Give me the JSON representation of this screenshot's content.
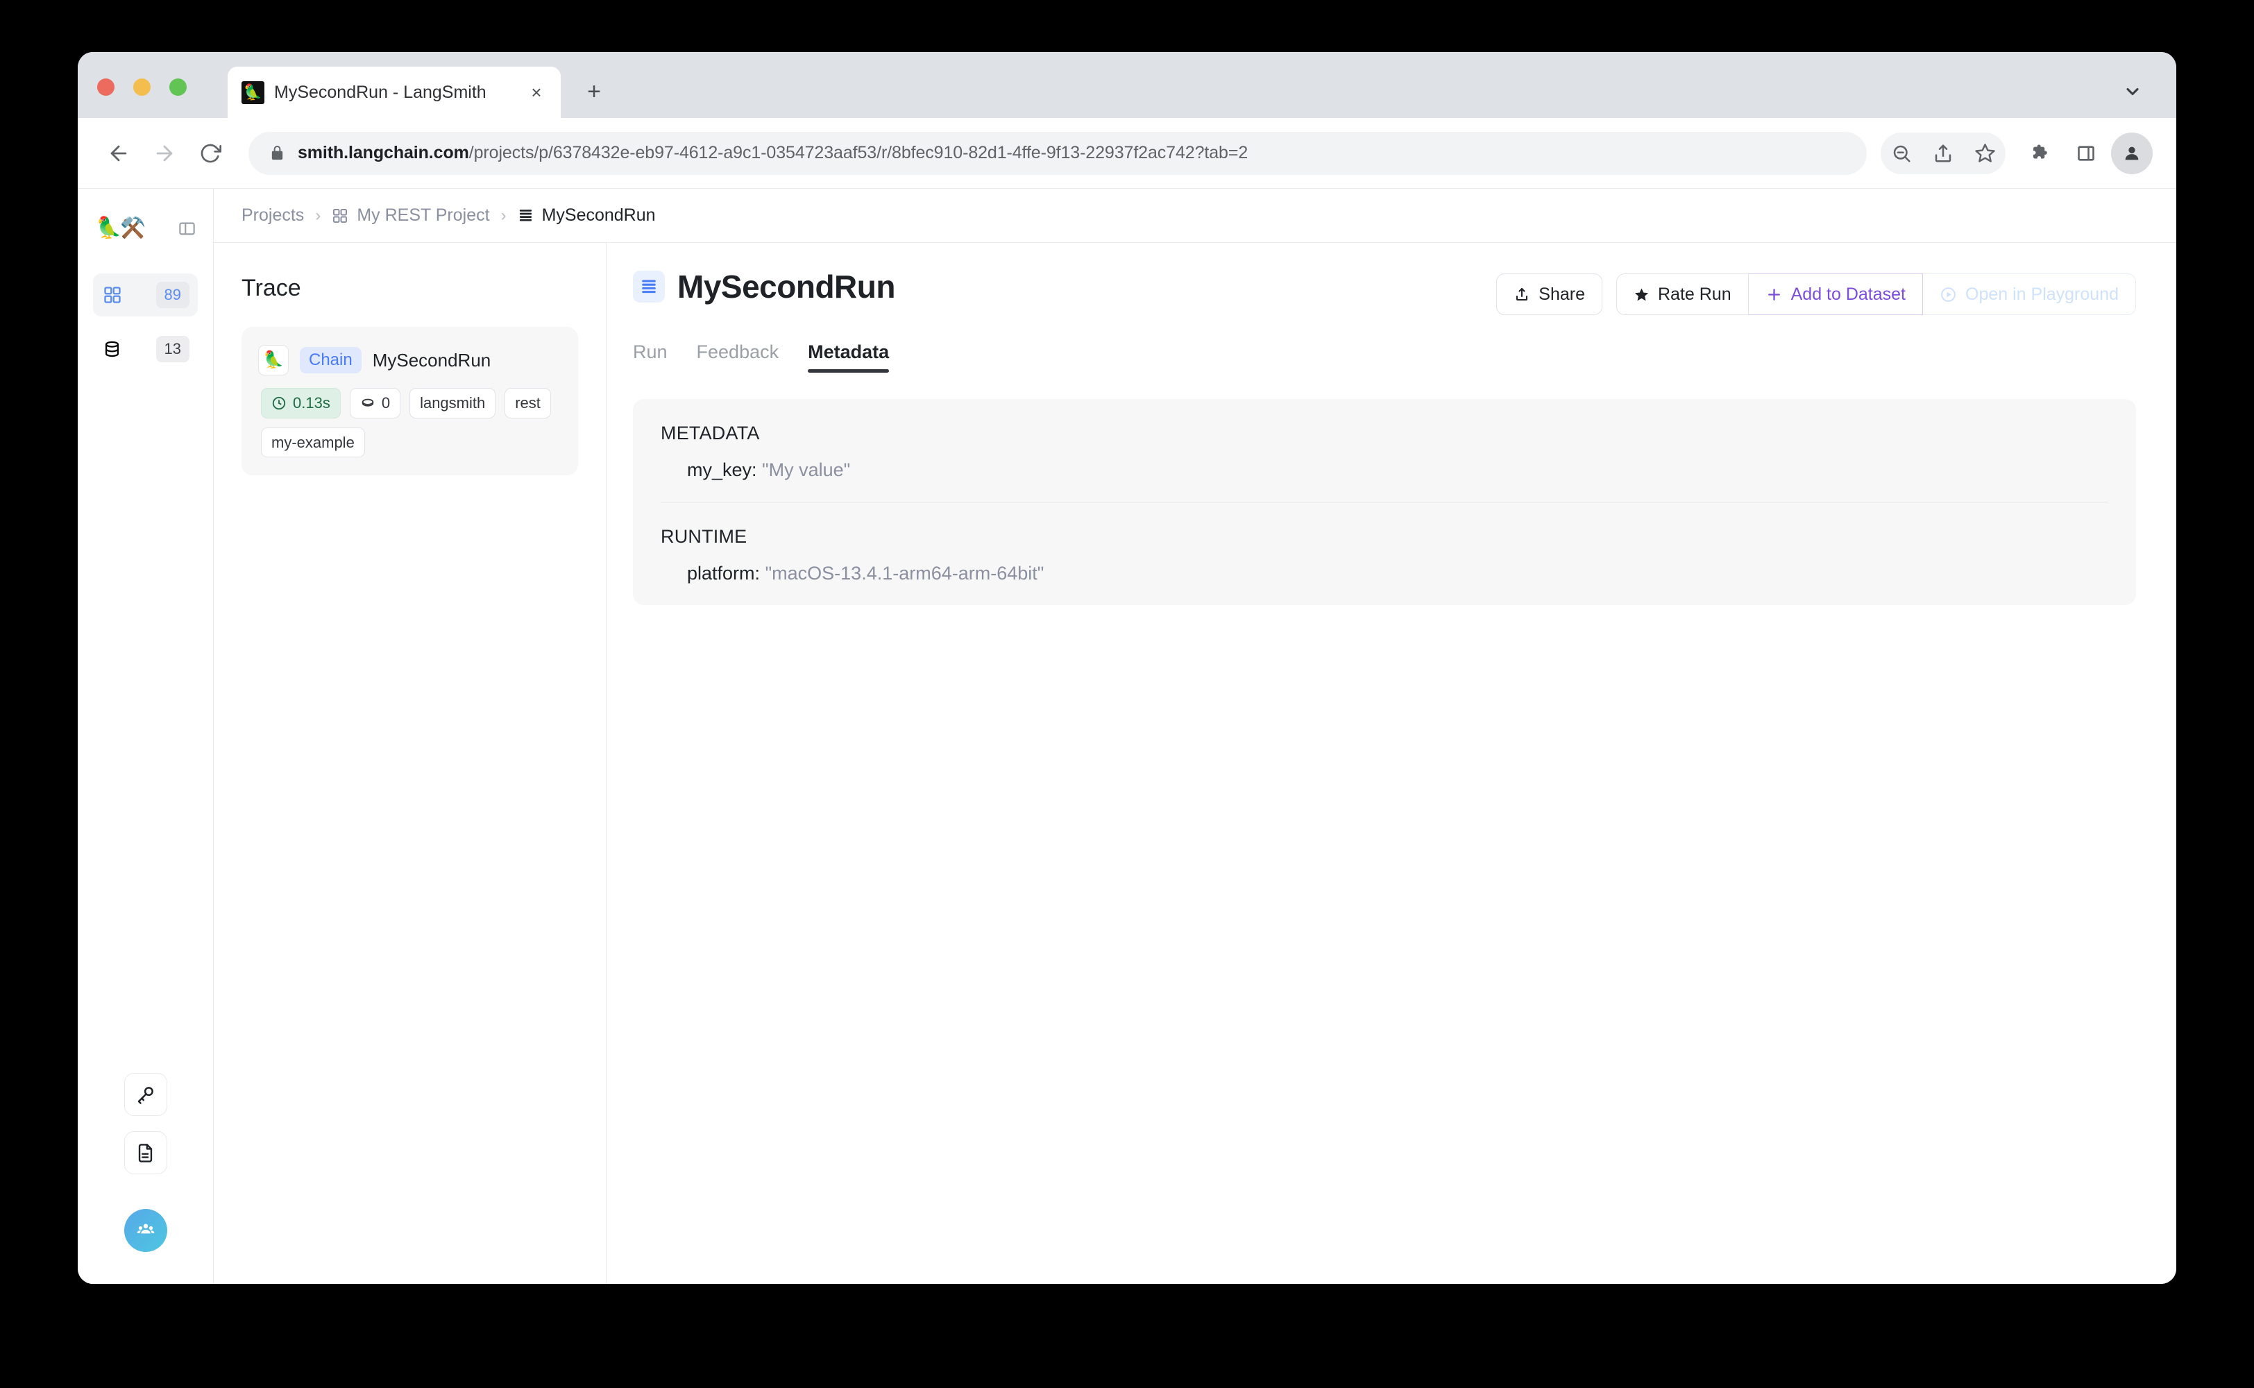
{
  "browser": {
    "tab": {
      "title": "MySecondRun - LangSmith",
      "favicon": "parrot-icon",
      "close_label": "×",
      "new_tab_label": "+"
    },
    "tabstrip_chevron": "chevron-down-icon",
    "toolbar": {
      "back": "back-arrow-icon",
      "forward": "forward-arrow-icon",
      "reload": "reload-icon",
      "lock": "lock-icon",
      "url_host": "smith.langchain.com",
      "url_path": "/projects/p/6378432e-eb97-4612-a9c1-0354723aaf53/r/8bfec910-82d1-4ffe-9f13-22937f2ac742?tab=2",
      "icons": [
        "zoom-out-icon",
        "share-icon",
        "bookmark-star-icon",
        "extensions-puzzle-icon",
        "side-panel-icon",
        "profile-avatar-icon"
      ]
    }
  },
  "rail": {
    "logo": "🦜⚒️",
    "panel_toggle": "panel-toggle-icon",
    "items": [
      {
        "icon": "grid-projects-icon",
        "count": "89",
        "active": true
      },
      {
        "icon": "database-datasets-icon",
        "count": "13",
        "active": false
      }
    ],
    "bottom": [
      {
        "icon": "key-icon"
      },
      {
        "icon": "document-icon"
      }
    ],
    "avatar_icon": "organization-people-icon"
  },
  "breadcrumb": {
    "items": [
      {
        "label": "Projects",
        "icon": null,
        "current": false
      },
      {
        "label": "My REST Project",
        "icon": "grid-projects-icon",
        "current": false
      },
      {
        "label": "MySecondRun",
        "icon": "run-stack-icon",
        "current": true
      }
    ],
    "separator": "›"
  },
  "trace": {
    "heading": "Trace",
    "card": {
      "emoji": "🦜",
      "type_badge": "Chain",
      "name": "MySecondRun",
      "chips": [
        {
          "label": "0.13s",
          "icon": "clock-icon",
          "style": "time"
        },
        {
          "label": "0",
          "icon": "token-coin-icon",
          "style": "plain"
        },
        {
          "label": "langsmith",
          "icon": null,
          "style": "plain"
        },
        {
          "label": "rest",
          "icon": null,
          "style": "plain"
        },
        {
          "label": "my-example",
          "icon": null,
          "style": "plain"
        }
      ]
    }
  },
  "main": {
    "title": "MySecondRun",
    "title_icon": "run-stack-icon",
    "actions": [
      {
        "label": "Share",
        "icon": "share-upload-icon",
        "variant": "default"
      },
      {
        "label": "Rate Run",
        "icon": "star-icon",
        "variant": "default"
      },
      {
        "label": "Add to Dataset",
        "icon": "plus-icon",
        "variant": "purple"
      },
      {
        "label": "Open in Playground",
        "icon": "play-circle-icon",
        "variant": "disabled"
      }
    ],
    "tabs": [
      {
        "label": "Run",
        "active": false
      },
      {
        "label": "Feedback",
        "active": false
      },
      {
        "label": "Metadata",
        "active": true
      }
    ],
    "metadata_panel": {
      "sections": [
        {
          "title": "METADATA",
          "entries": [
            {
              "key": "my_key:",
              "value": "\"My value\""
            }
          ]
        },
        {
          "title": "RUNTIME",
          "entries": [
            {
              "key": "platform:",
              "value": "\"macOS-13.4.1-arm64-arm-64bit\""
            }
          ]
        }
      ]
    }
  },
  "colors": {
    "accent_blue": "#4a7bf7",
    "accent_purple": "#7c4ddb",
    "success_green": "#1f6b45",
    "panel_bg": "#f7f7f8"
  }
}
